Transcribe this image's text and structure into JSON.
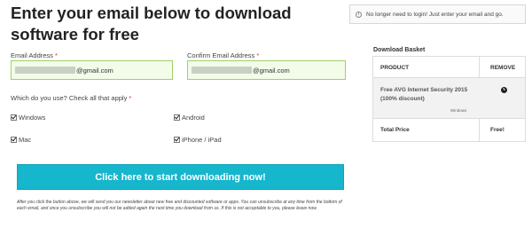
{
  "page": {
    "title": "Enter your email below to download software for free"
  },
  "form": {
    "email_label": "Email Address",
    "confirm_label": "Confirm Email Address",
    "required_mark": "*",
    "email_value_suffix": "@gmail.com",
    "confirm_value_suffix": "@gmail.com",
    "question": "Which do you use? Check all that apply",
    "options": [
      {
        "label": "Windows",
        "checked": true
      },
      {
        "label": "Android",
        "checked": true
      },
      {
        "label": "Mac",
        "checked": true
      },
      {
        "label": "iPhone / iPad",
        "checked": true
      }
    ],
    "submit_label": "Click here to start downloading now!",
    "fine_print": "After you click the button above, we will send you our newsletter about new free and discounted software or apps. You can unsubscribe at any time from the bottom of each email, and once you unsubscribe you will not be added again the next time you download from us. If this is not acceptable to you, please leave now."
  },
  "notice": {
    "icon": "info-icon",
    "text": "No longer need to login! Just enter your email and go."
  },
  "basket": {
    "title": "Download Basket",
    "col_product": "PRODUCT",
    "col_remove": "REMOVE",
    "item_name": "Free AVG Internet Security 2015 (100% discount)",
    "item_platform": "Windows",
    "remove_icon": "remove-icon",
    "total_label": "Total Price",
    "total_value": "Free!"
  },
  "colors": {
    "accent": "#16b6cd",
    "field_border": "#9bd36a"
  }
}
